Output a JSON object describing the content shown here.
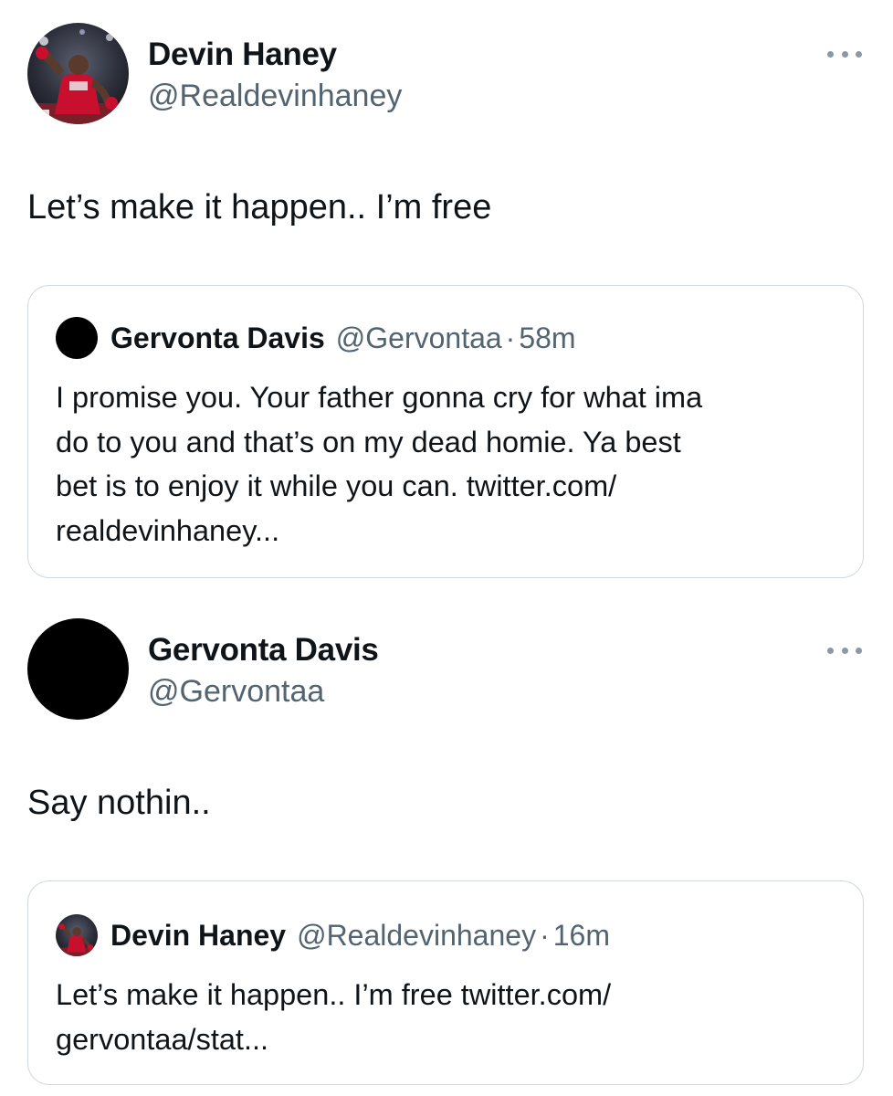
{
  "tweets": [
    {
      "author": {
        "name": "Devin Haney",
        "handle": "@Realdevinhaney",
        "avatar": "boxer-photo"
      },
      "text": "Let’s make it happen.. I’m free",
      "more_icon": "more-horizontal-icon",
      "quote": {
        "author": {
          "name": "Gervonta Davis",
          "handle": "@Gervontaa",
          "avatar": "black-circle"
        },
        "separator": "·",
        "time": "58m",
        "text": "I promise you. Your father gonna cry for what ima\ndo to you and that’s on my dead homie. Ya best\nbet is to enjoy it while you can. twitter.com/\nrealdevinhaney..."
      }
    },
    {
      "author": {
        "name": "Gervonta Davis",
        "handle": "@Gervontaa",
        "avatar": "black-circle"
      },
      "text": "Say nothin..",
      "more_icon": "more-horizontal-icon",
      "quote": {
        "author": {
          "name": "Devin Haney",
          "handle": "@Realdevinhaney",
          "avatar": "boxer-photo"
        },
        "separator": "·",
        "time": "16m",
        "text": "Let’s make it happen.. I’m free twitter.com/\ngervontaa/stat..."
      }
    }
  ],
  "colors": {
    "primary_text": "#0f1419",
    "secondary_text": "#536471",
    "border": "#cfd9de",
    "more_dots": "#8b98a5"
  }
}
